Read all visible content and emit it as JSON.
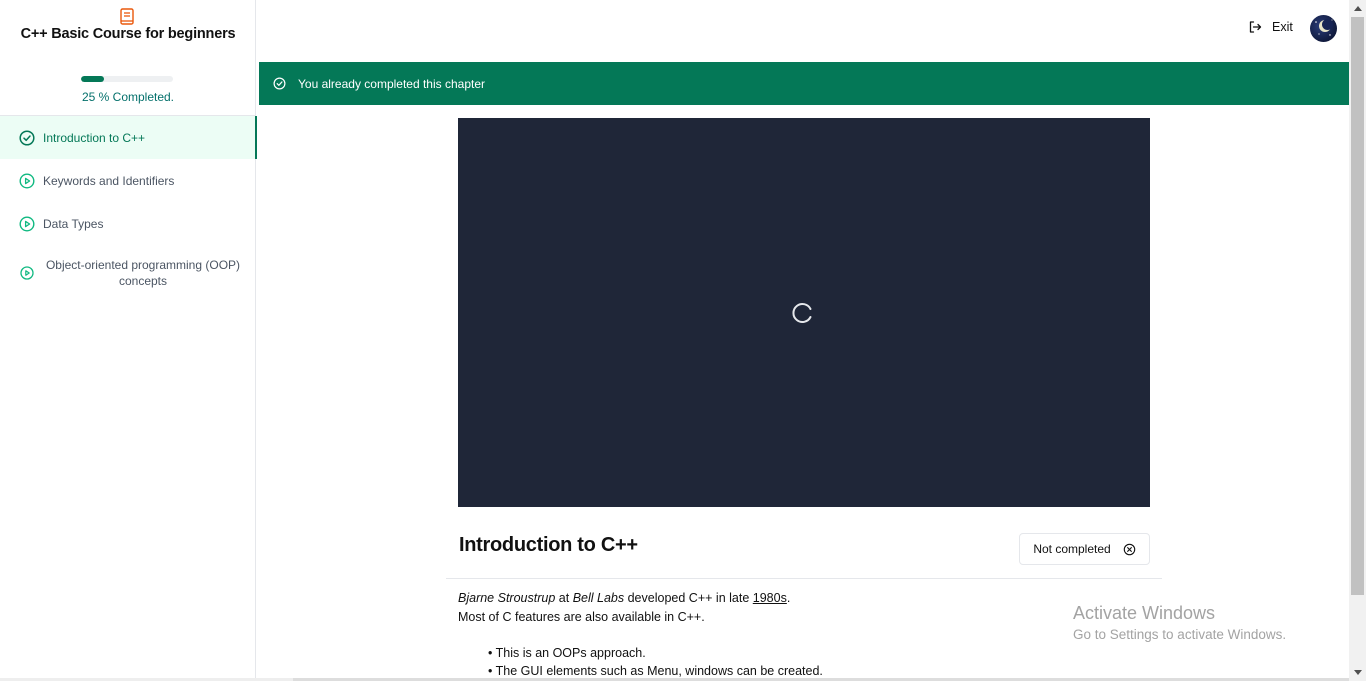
{
  "sidebar": {
    "logo_icon": "book-icon",
    "course_title": "C++ Basic Course for beginners",
    "progress": {
      "percent": 25,
      "label": "25 % Completed."
    },
    "items": [
      {
        "label": "Introduction to C++",
        "icon": "check-circle-icon",
        "active": true
      },
      {
        "label": "Keywords and Identifiers",
        "icon": "play-circle-icon",
        "active": false
      },
      {
        "label": "Data Types",
        "icon": "play-circle-icon",
        "active": false
      },
      {
        "label": "Object-oriented programming (OOP) concepts",
        "icon": "play-circle-icon",
        "active": false
      }
    ]
  },
  "header": {
    "exit_label": "Exit",
    "exit_icon": "logout-icon",
    "avatar_icon": "user-avatar"
  },
  "banner": {
    "text": "You already completed this chapter",
    "icon": "check-circle-icon",
    "color": "#047857"
  },
  "video": {
    "state_icon": "loading-spinner-icon",
    "background": "#1f2638"
  },
  "chapter": {
    "title": "Introduction to C++",
    "status_button": "Not completed",
    "status_icon": "x-circle-icon",
    "description": {
      "author": "Bjarne Stroustrup",
      "at": "at",
      "lab": "Bell Labs",
      "developed": "developed",
      "language": "C++",
      "in_late": "in late",
      "decade": "1980s",
      "period": ".",
      "line2_prefix": "Most of",
      "line2_c": "C",
      "line2_mid": "features are also available in",
      "line2_cpp": "C++",
      "line2_end": "."
    },
    "bullets": [
      "This is an OOPs approach.",
      "The GUI elements such as Menu, windows can be created."
    ]
  },
  "watermark": {
    "line1": "Activate Windows",
    "line2": "Go to Settings to activate Windows."
  },
  "colors": {
    "accent": "#047857",
    "active_bg": "#ecfdf5",
    "logo": "#ea580c"
  }
}
